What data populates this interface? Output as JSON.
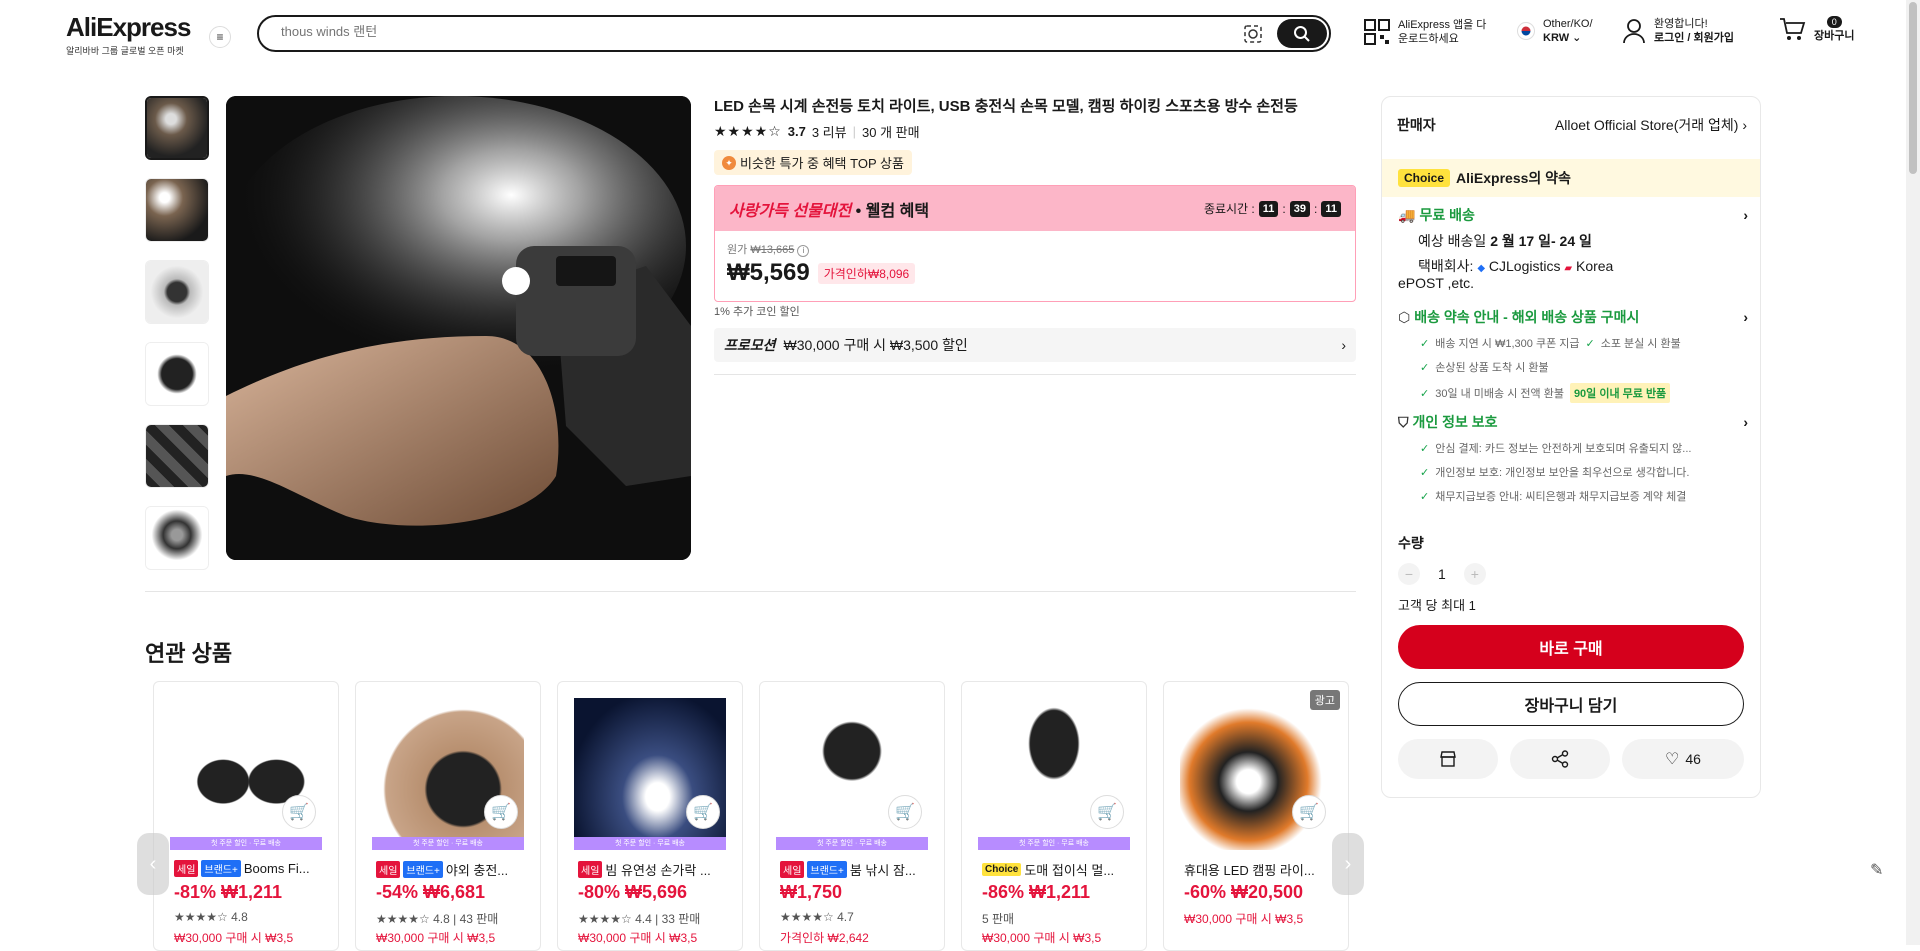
{
  "header": {
    "logo_word": "AliExpress",
    "logo_tagline": "알리바바 그룹 글로벌 오픈 마켓",
    "search_placeholder": "thous winds 랜턴",
    "app_line1": "AliExpress 앱을 다",
    "app_line2": "운로드하세요",
    "region_line1": "Other/KO/",
    "region_line2": "KRW",
    "account_line1": "환영합니다!",
    "account_line2": "로그인 / 회원가입",
    "cart_count": "0",
    "cart_label": "장바구니"
  },
  "product": {
    "title": "LED 손목 시계 손전등 토치 라이트, USB 충전식 손목 모델, 캠핑 하이킹 스포츠용 방수 손전등",
    "stars": "★★★★☆",
    "rating": "3.7",
    "reviews": "3 리뷰",
    "sold": "30 개 판매",
    "top_chip": "비슷한 특가 중 혜택 TOP 상품",
    "promo_brand": "사랑가득 선물대전",
    "promo_sub": "• 웰컴 혜택",
    "countdown_label": "종료시간 :",
    "countdown_h": "11",
    "countdown_m": "39",
    "countdown_s": "11",
    "orig_label": "원가",
    "orig_price": "₩13,665",
    "price": "₩5,569",
    "discount_badge": "가격인하₩8,096",
    "coin_line": "1% 추가 코인 할인",
    "promotion_label": "프로모션",
    "promotion_text": "₩30,000 구매 시 ₩3,500 할인"
  },
  "panel": {
    "seller_label": "판매자",
    "seller_name": "Alloet Official Store(거래 업체)",
    "choice_tag": "Choice",
    "choice_text": "AliExpress의 약속",
    "free_ship": "무료 배송",
    "eta_prefix": "예상 배송일",
    "eta_value": "2 월 17 일- 24 일",
    "carrier_label": "택배회사:",
    "carrier_1": "CJLogistics",
    "carrier_2": "Korea",
    "carrier_3": "ePOST ,etc.",
    "promise_title": "배송 약속 안내 - 해외 배송 상품 구매시",
    "promise_items": [
      "배송 지연 시 ₩1,300 쿠폰 지급",
      "소포 분실 시 환불",
      "손상된 상품 도착 시 환불",
      "30일 내 미배송 시 전액 환불"
    ],
    "return_badge": "90일 이내 무료 반품",
    "privacy_title": "개인 정보 보호",
    "privacy_items": [
      "안심 결제: 카드 정보는 안전하게 보호되며 유출되지 않...",
      "개인정보 보호: 개인정보 보안을 최우선으로 생각합니다.",
      "채무지급보증 안내: 씨티은행과 채무지급보증 계약 체결"
    ],
    "qty_label": "수량",
    "qty_value": "1",
    "qty_limit": "고객 당 최대 1",
    "buy_now": "바로 구매",
    "add_cart": "장바구니 담기",
    "wishlist_count": "46"
  },
  "related": {
    "title": "연관 상품",
    "ad_badge": "광고",
    "band_text": "첫 주문 할인 · 무료 배송",
    "cards": [
      {
        "tag1": "세일",
        "tag2": "브랜드+",
        "name": "Booms Fi...",
        "price": "-81% ₩1,211",
        "meta": "★★★★☆ 4.8",
        "coupon": "₩30,000 구매 시 ₩3,5"
      },
      {
        "tag1": "세일",
        "tag2": "브랜드+",
        "name": "야외 충전...",
        "price": "-54% ₩6,681",
        "meta": "★★★★☆ 4.8 | 43 판매",
        "coupon": "₩30,000 구매 시 ₩3,5"
      },
      {
        "tag1": "세일",
        "tag2": "",
        "name": "빔 유연성 손가락 ...",
        "price": "-80% ₩5,696",
        "meta": "★★★★☆ 4.4 | 33 판매",
        "coupon": "₩30,000 구매 시 ₩3,5"
      },
      {
        "tag1": "세일",
        "tag2": "브랜드+",
        "name": "붐 낚시 잠...",
        "price": "₩1,750",
        "meta": "★★★★☆ 4.7",
        "coupon": "가격인하 ₩2,642"
      },
      {
        "tag1": "Choice",
        "tag2": "",
        "name": "도매 접이식 멀...",
        "price": "-86% ₩1,211",
        "meta": "5 판매",
        "coupon": "₩30,000 구매 시 ₩3,5"
      },
      {
        "tag1": "",
        "tag2": "",
        "name": "휴대용 LED 캠핑 라이...",
        "price": "-60% ₩20,500",
        "meta": "",
        "coupon": "₩30,000 구매 시 ₩3,5"
      }
    ]
  }
}
